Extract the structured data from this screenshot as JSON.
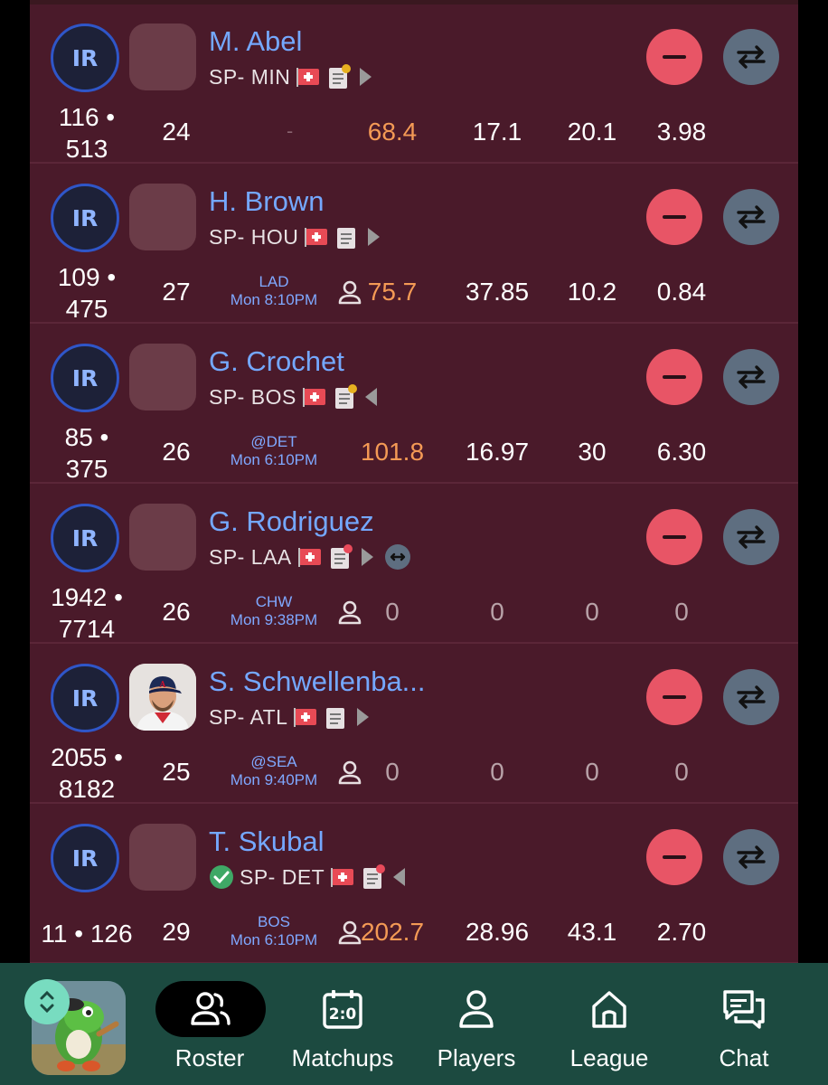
{
  "players": [
    {
      "ir": "IR",
      "name": "M. Abel",
      "pos": "SP- MIN",
      "checked": false,
      "arrow": "right",
      "extra_trade": false,
      "note_dot": "#e6b020",
      "photo": false,
      "rank": "116 •",
      "rank2": "513",
      "age": "24",
      "opp1": "",
      "opp2": "",
      "opp_dash": "-",
      "has_person": false,
      "stats": [
        "68.4",
        "17.1",
        "20.1",
        "3.98"
      ]
    },
    {
      "ir": "IR",
      "name": "H. Brown",
      "pos": "SP- HOU",
      "checked": false,
      "arrow": "right",
      "extra_trade": false,
      "note_dot": "",
      "photo": false,
      "rank": "109 •",
      "rank2": "475",
      "age": "27",
      "opp1": "LAD",
      "opp2": "Mon 8:10PM",
      "opp_dash": "",
      "has_person": true,
      "stats": [
        "75.7",
        "37.85",
        "10.2",
        "0.84"
      ]
    },
    {
      "ir": "IR",
      "name": "G. Crochet",
      "pos": "SP- BOS",
      "checked": false,
      "arrow": "left",
      "extra_trade": false,
      "note_dot": "#e6b020",
      "photo": false,
      "rank": "85 •",
      "rank2": "375",
      "age": "26",
      "opp1": "@DET",
      "opp2": "Mon 6:10PM",
      "opp_dash": "",
      "has_person": false,
      "stats": [
        "101.8",
        "16.97",
        "30",
        "6.30"
      ]
    },
    {
      "ir": "IR",
      "name": "G. Rodriguez",
      "pos": "SP- LAA",
      "checked": false,
      "arrow": "right",
      "extra_trade": true,
      "note_dot": "#e84a5a",
      "photo": false,
      "rank": "1942 •",
      "rank2": "7714",
      "age": "26",
      "opp1": "CHW",
      "opp2": "Mon 9:38PM",
      "opp_dash": "",
      "has_person": true,
      "stats": [
        "0",
        "0",
        "0",
        "0"
      ]
    },
    {
      "ir": "IR",
      "name": "S. Schwellenba...",
      "pos": "SP- ATL",
      "checked": false,
      "arrow": "right",
      "extra_trade": false,
      "note_dot": "",
      "photo": true,
      "rank": "2055 •",
      "rank2": "8182",
      "age": "25",
      "opp1": "@SEA",
      "opp2": "Mon 9:40PM",
      "opp_dash": "",
      "has_person": true,
      "stats": [
        "0",
        "0",
        "0",
        "0"
      ]
    },
    {
      "ir": "IR",
      "name": "T. Skubal",
      "pos": "SP- DET",
      "checked": true,
      "arrow": "left",
      "extra_trade": false,
      "note_dot": "#e84a5a",
      "photo": false,
      "rank": "11 • 126",
      "rank2": "",
      "age": "29",
      "opp1": "BOS",
      "opp2": "Mon 6:10PM",
      "opp_dash": "",
      "has_person": true,
      "stats": [
        "202.7",
        "28.96",
        "43.1",
        "2.70"
      ]
    }
  ],
  "nav": {
    "items": [
      {
        "label": "Roster",
        "icon": "roster-icon",
        "active": true
      },
      {
        "label": "Matchups",
        "icon": "matchups-icon",
        "active": false
      },
      {
        "label": "Players",
        "icon": "players-icon",
        "active": false
      },
      {
        "label": "League",
        "icon": "league-icon",
        "active": false
      },
      {
        "label": "Chat",
        "icon": "chat-icon",
        "active": false
      }
    ]
  },
  "colors": {
    "accent_name": "#74a8ff",
    "fantasy_points": "#f49a55",
    "drop": "#e85566",
    "trade": "#5e6e80",
    "nav_bg": "#1c4a40"
  }
}
